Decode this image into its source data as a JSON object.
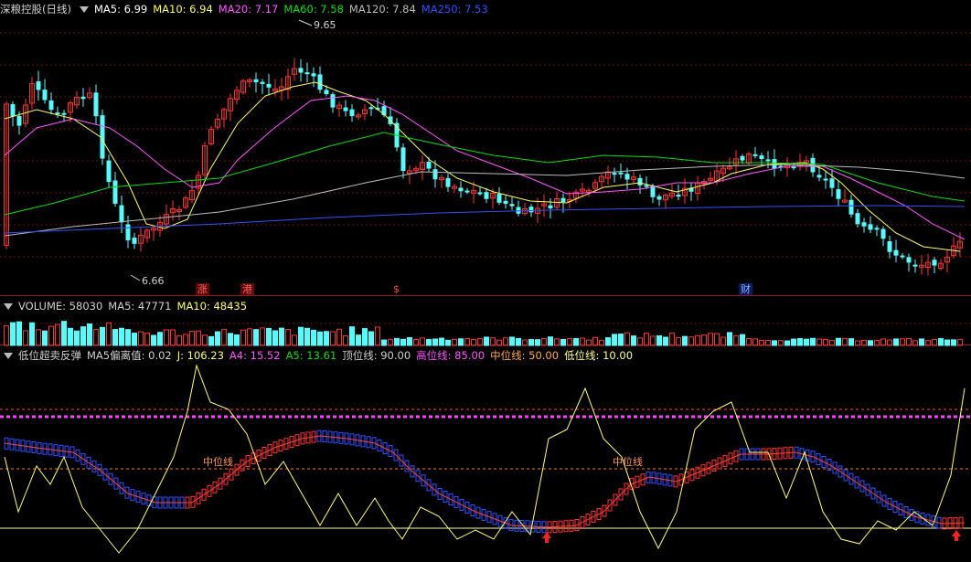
{
  "main_panel": {
    "stock_name": "深粮控股(日线)",
    "ma5": "MA5: 6.99",
    "ma10": "MA10: 6.94",
    "ma20": "MA20: 7.17",
    "ma60": "MA60: 7.58",
    "ma120": "MA120: 7.84",
    "ma250": "MA250: 7.53",
    "high_label": "9.65",
    "low_label": "6.66",
    "markers": [
      "涨",
      "港",
      "$",
      "财"
    ]
  },
  "volume_panel": {
    "volume": "VOLUME: 58030",
    "ma5": "MA5: 47771",
    "ma10": "MA10: 48435"
  },
  "indicator_panel": {
    "name": "低位超卖反弹",
    "deviation": "MA5偏离值: 0.02",
    "j": "J: 106.23",
    "a4": "A4: 15.52",
    "a5": "A5: 13.61",
    "top": "顶位线: 90.00",
    "high": "高位线: 85.00",
    "mid": "中位线: 50.00",
    "low": "低位线: 10.00",
    "mid_label_1": "中位线",
    "mid_label_2": "中位线"
  },
  "colors": {
    "up": "#ff3232",
    "down": "#54ffff",
    "ma5": "#ffffff",
    "ma10": "#ffff55",
    "ma20": "#ff55ff",
    "ma60": "#00e000",
    "ma120": "#bbbbbb",
    "ma250": "#3050ff",
    "high_line": "#ff44ff",
    "mid_line": "#ffaa44",
    "low_line": "#ffff88",
    "j_line": "#ffff66"
  }
}
